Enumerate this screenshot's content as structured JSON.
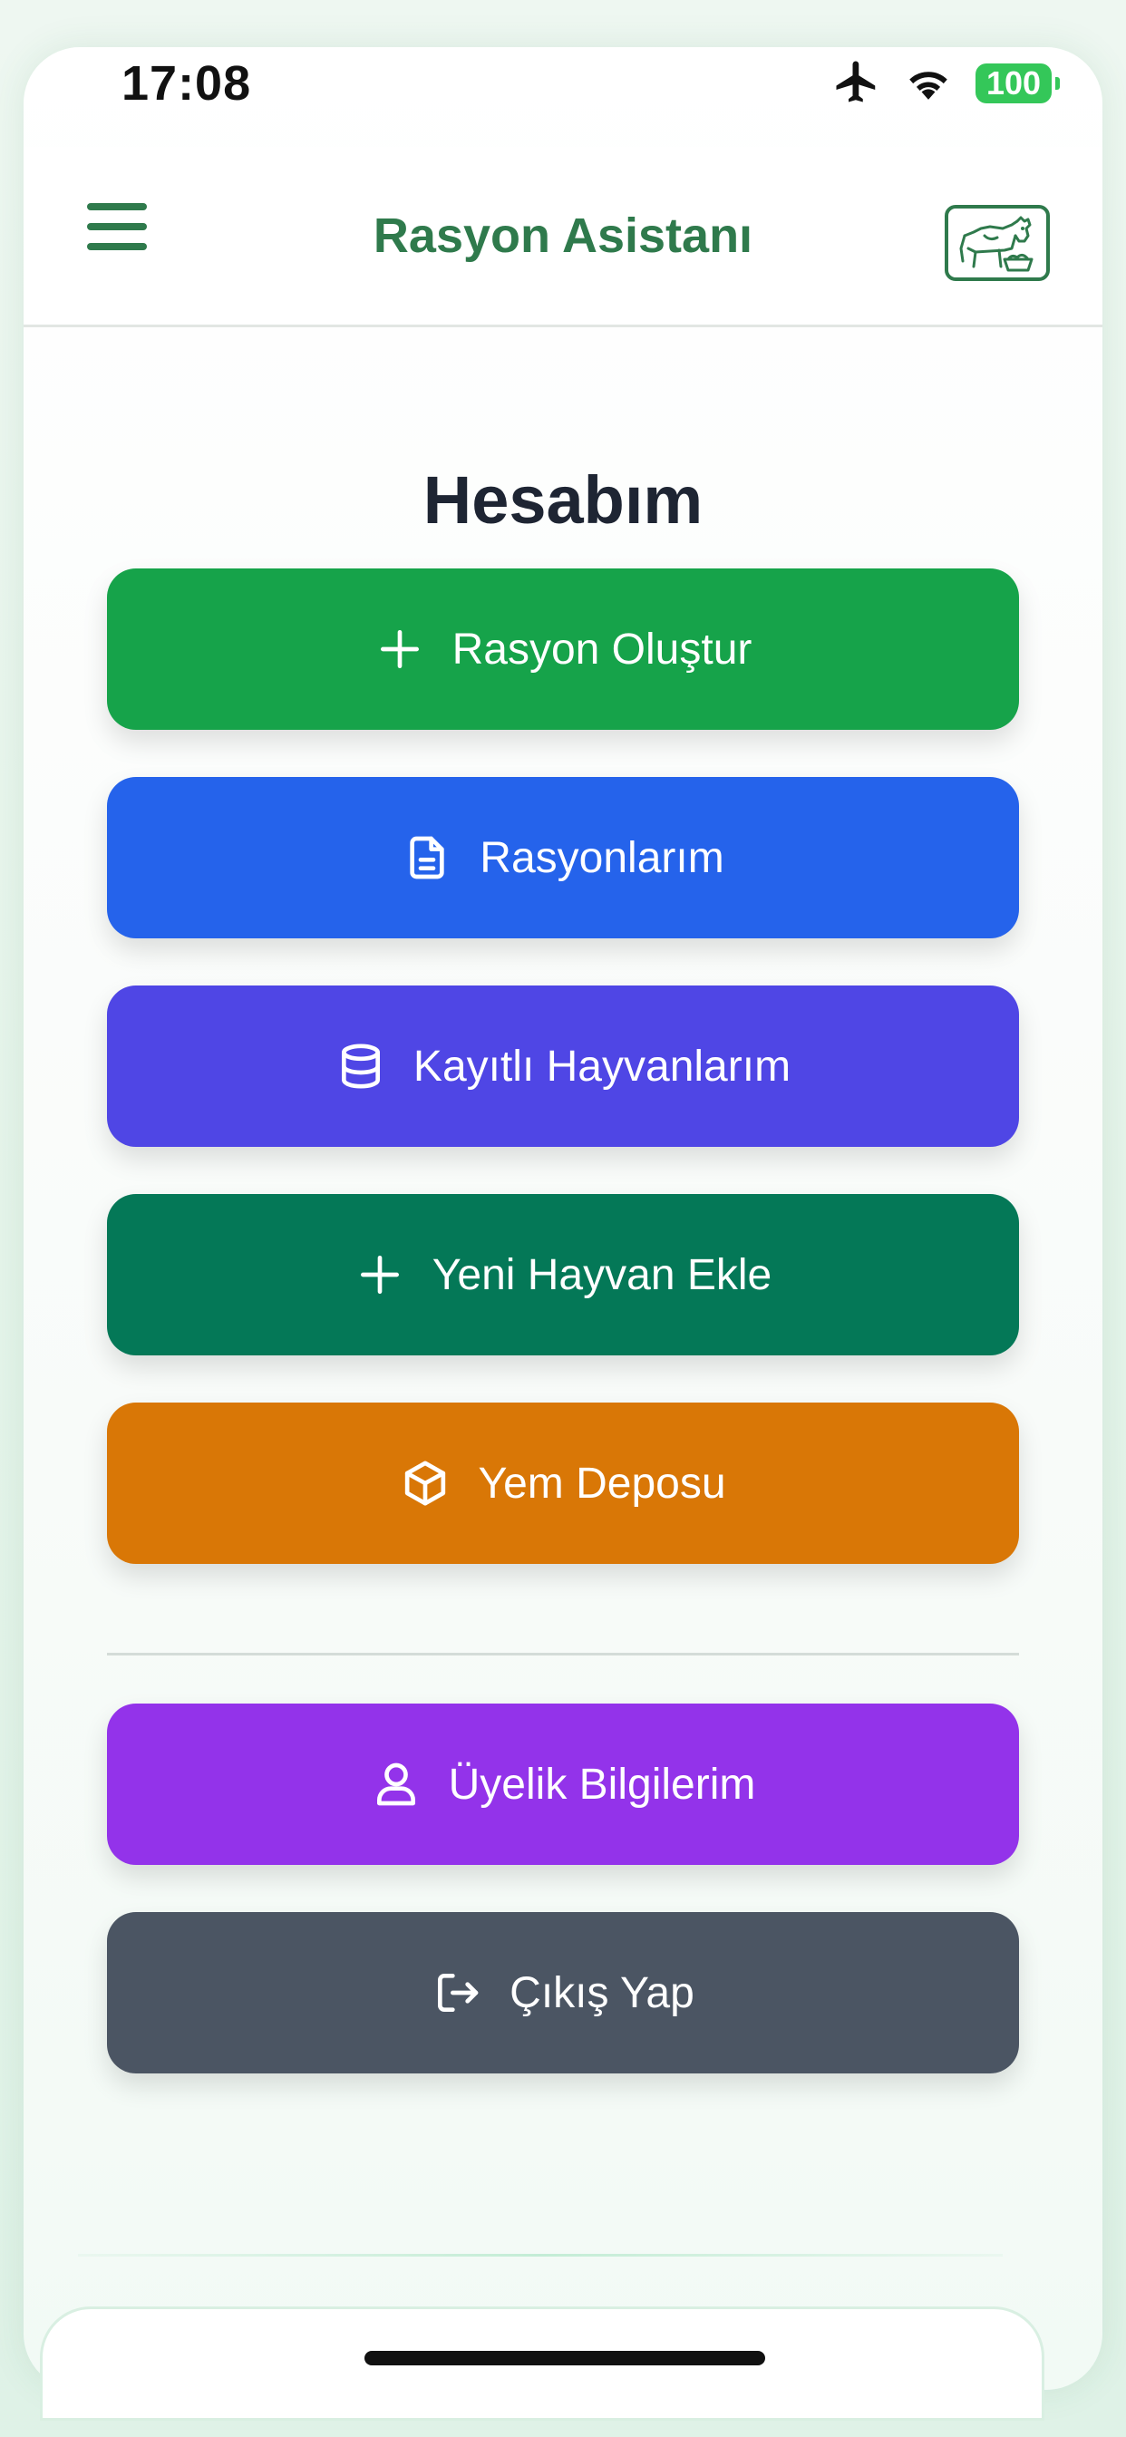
{
  "status_bar": {
    "time": "17:08",
    "battery": "100",
    "icons": [
      "airplane-icon",
      "wifi-icon",
      "battery-icon"
    ]
  },
  "header": {
    "title": "Rasyon Asistanı",
    "menu_icon": "hamburger-menu-icon",
    "logo_icon": "cow-logo-icon"
  },
  "page": {
    "title": "Hesabım"
  },
  "menu": {
    "items": [
      {
        "label": "Rasyon Oluştur",
        "icon": "plus-icon",
        "color": "#16a34a"
      },
      {
        "label": "Rasyonlarım",
        "icon": "document-icon",
        "color": "#2563eb"
      },
      {
        "label": "Kayıtlı Hayvanlarım",
        "icon": "database-icon",
        "color": "#4f46e5"
      },
      {
        "label": "Yeni Hayvan Ekle",
        "icon": "plus-icon",
        "color": "#047857"
      },
      {
        "label": "Yem Deposu",
        "icon": "box-icon",
        "color": "#d97706"
      },
      {
        "label": "Üyelik Bilgilerim",
        "icon": "user-icon",
        "color": "#9333ea"
      },
      {
        "label": "Çıkış Yap",
        "icon": "logout-icon",
        "color": "#4b5563"
      }
    ]
  },
  "colors": {
    "brand": "#2f7a4c",
    "page_title": "#1e2533"
  }
}
